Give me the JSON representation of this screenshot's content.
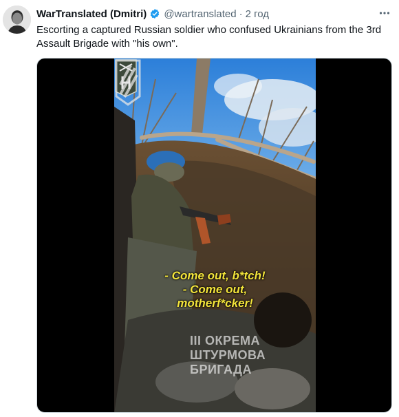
{
  "tweet": {
    "author_name": "WarTranslated (Dmitri)",
    "verified": true,
    "handle": "@wartranslated",
    "separator": "·",
    "time": "2 год",
    "more_icon": "more-horizontal-icon",
    "text": "Escorting a captured Russian soldier who confused Ukrainians from the 3rd Assault Brigade with \"his own\".",
    "colors": {
      "verified": "#1d9bf0",
      "muted": "#536471",
      "text": "#0f1419"
    }
  },
  "media": {
    "type": "video",
    "subtitles": [
      "- Come out, b*tch!",
      "- Come out,",
      "motherf*cker!"
    ],
    "watermark": [
      "III ОКРЕМА",
      "ШТУРМОВА",
      "БРИГАДА"
    ],
    "subtitle_color": "#f4e53b"
  }
}
